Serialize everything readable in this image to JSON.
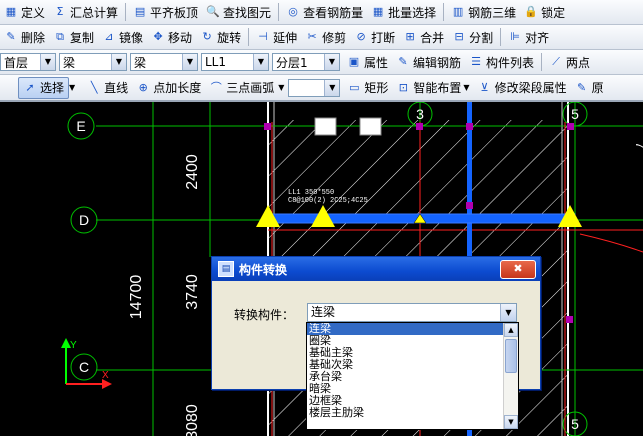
{
  "toolbar1": [
    {
      "icon": "define-icon",
      "glyph": "▦",
      "label": "定义"
    },
    {
      "icon": "sum-icon",
      "glyph": "Σ",
      "label": "汇总计算"
    },
    {
      "icon": "board-top-icon",
      "glyph": "▤",
      "label": "平齐板顶"
    },
    {
      "icon": "find-icon",
      "glyph": "🔍",
      "label": "查找图元"
    },
    {
      "icon": "view-rebar-icon",
      "glyph": "◎",
      "label": "查看钢筋量"
    },
    {
      "icon": "batch-select-icon",
      "glyph": "▦",
      "label": "批量选择"
    },
    {
      "icon": "rebar-3d-icon",
      "glyph": "▥",
      "label": "钢筋三维"
    },
    {
      "icon": "lock-icon",
      "glyph": "🔒",
      "label": "锁定"
    }
  ],
  "toolbar2": [
    {
      "icon": "delete-icon",
      "glyph": "✎",
      "label": "删除"
    },
    {
      "icon": "copy-icon",
      "glyph": "⧉",
      "label": "复制"
    },
    {
      "icon": "mirror-icon",
      "glyph": "⊿",
      "label": "镜像"
    },
    {
      "icon": "move-icon",
      "glyph": "✥",
      "label": "移动"
    },
    {
      "icon": "rotate-icon",
      "glyph": "↻",
      "label": "旋转"
    },
    {
      "icon": "extend-icon",
      "glyph": "⊣",
      "label": "延伸"
    },
    {
      "icon": "trim-icon",
      "glyph": "✂",
      "label": "修剪"
    },
    {
      "icon": "break-icon",
      "glyph": "⊘",
      "label": "打断"
    },
    {
      "icon": "merge-icon",
      "glyph": "⊞",
      "label": "合并"
    },
    {
      "icon": "split-icon",
      "glyph": "⊟",
      "label": "分割"
    },
    {
      "icon": "align-icon",
      "glyph": "⊫",
      "label": "对齐"
    }
  ],
  "toolbar3": {
    "floor": "首层",
    "category": "梁",
    "type": "梁",
    "component": "LL1",
    "layer": "分层1",
    "properties_label": "属性",
    "edit_rebar_label": "编辑钢筋",
    "component_list_label": "构件列表",
    "two_points_label": "两点"
  },
  "toolbar4": {
    "select_label": "选择",
    "line_label": "直线",
    "point_length_label": "点加长度",
    "arc_label": "三点画弧",
    "rect_label": "矩形",
    "smart_layout_label": "智能布置",
    "modify_span_label": "修改梁段属性",
    "orig_label": "原"
  },
  "drawing": {
    "axes": [
      "E",
      "D",
      "C",
      "3",
      "5"
    ],
    "dims": [
      "2400",
      "3740",
      "14700",
      "3080"
    ],
    "beam_annotation_1": "LL1 350*550",
    "beam_annotation_2": "C8@100(2) 2C25;4C25"
  },
  "colors": {
    "grid": "#00c000",
    "wall": "#ffffff",
    "beam": "#1464ff",
    "column": "#ff2020",
    "support": "#ffff00"
  },
  "dialog": {
    "title": "构件转换",
    "close_glyph": "✖",
    "label": "转换构件：",
    "selected": "连梁",
    "options": [
      "连梁",
      "圈梁",
      "基础主梁",
      "基础次梁",
      "承台梁",
      "暗梁",
      "边框梁",
      "楼层主肋梁"
    ]
  }
}
